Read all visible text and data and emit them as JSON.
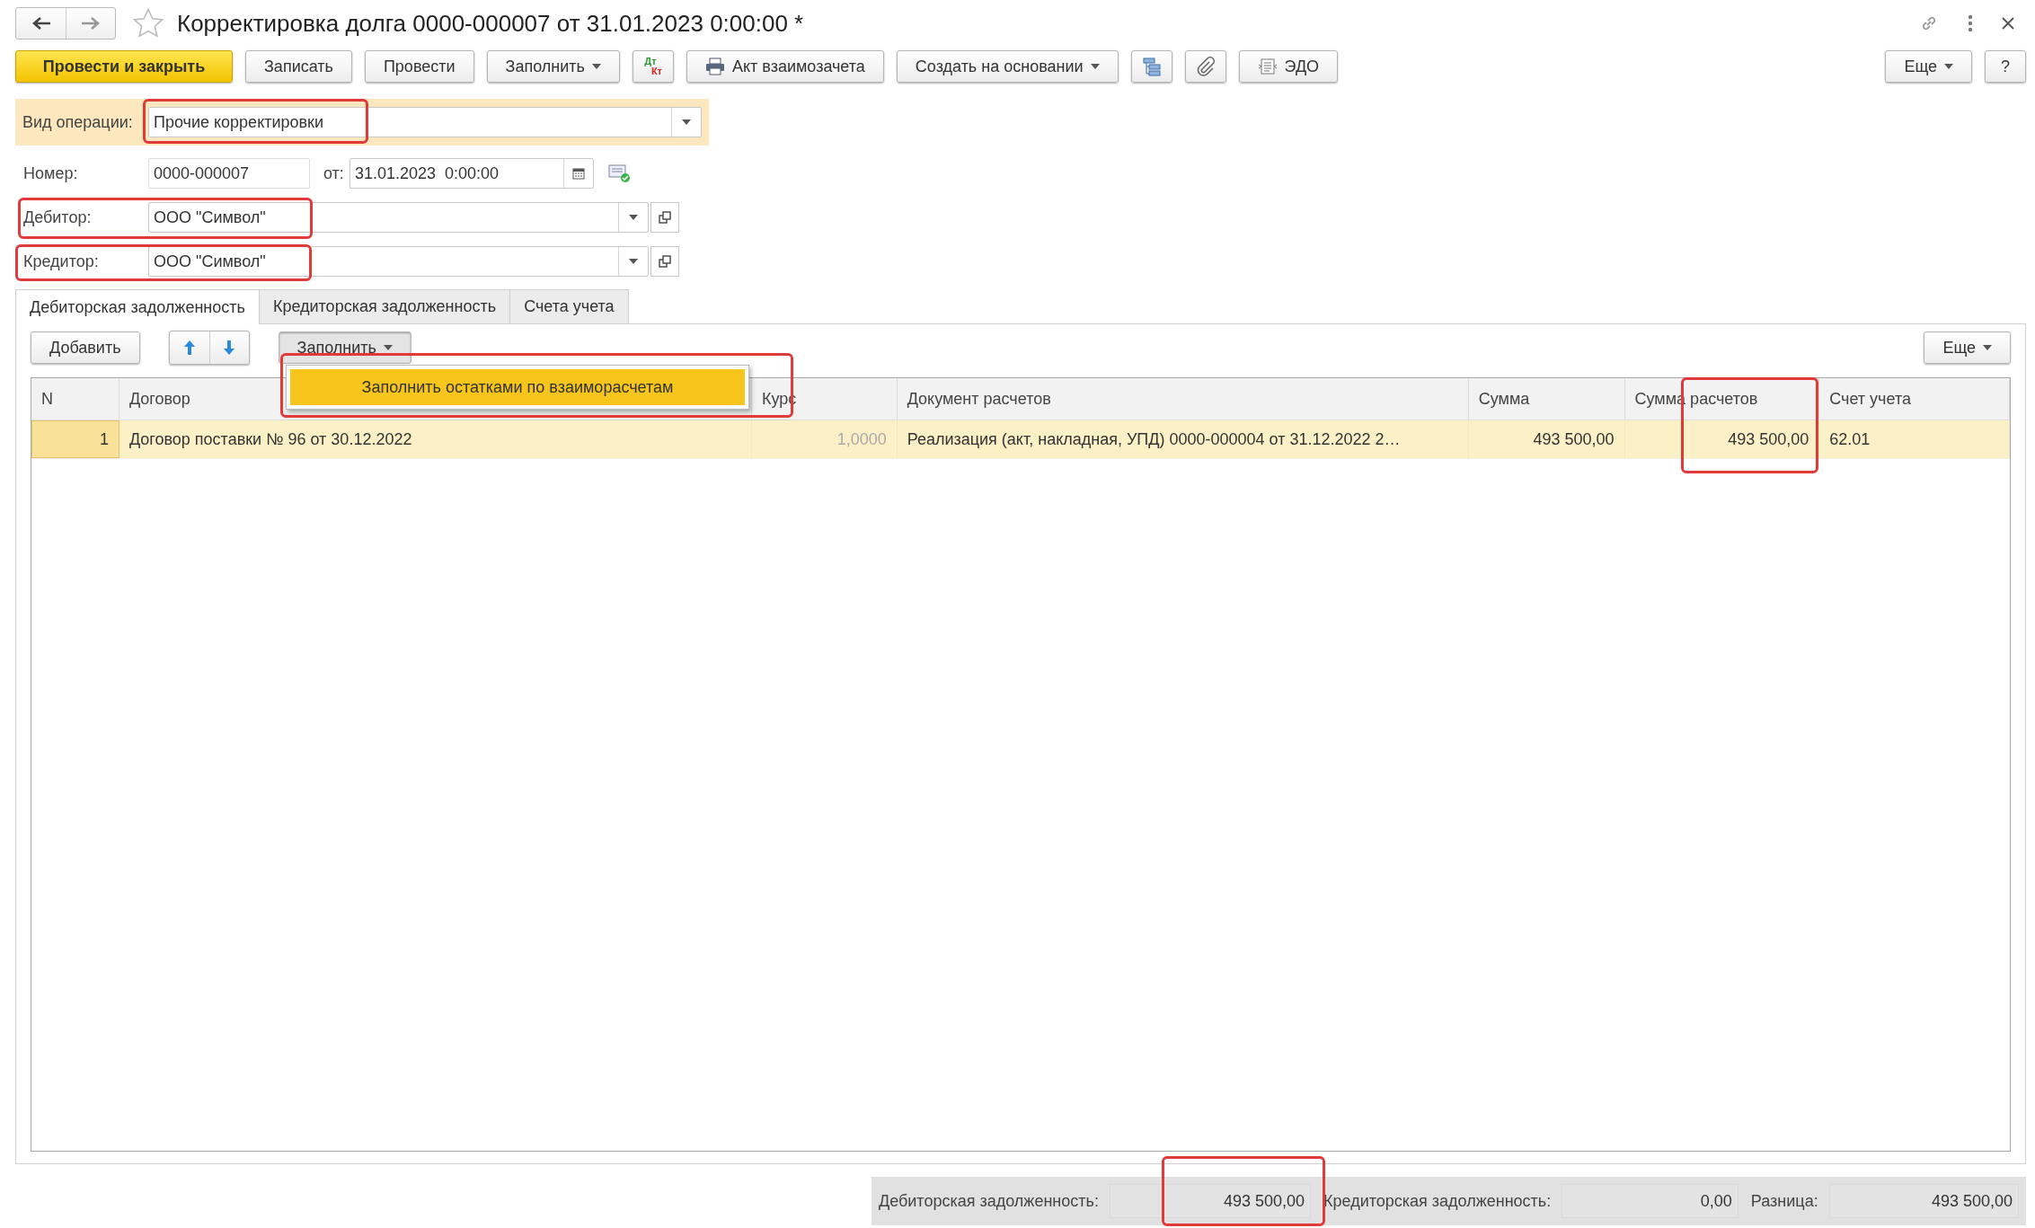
{
  "window": {
    "title": "Корректировка долга 0000-000007 от 31.01.2023 0:00:00 *",
    "starred": false
  },
  "toolbar": [
    {
      "kind": "primary",
      "label": "Провести и закрыть"
    },
    {
      "kind": "plain",
      "label": "Записать"
    },
    {
      "kind": "plain",
      "label": "Провести"
    },
    {
      "kind": "dropdown",
      "label": "Заполнить"
    },
    {
      "kind": "dtkt",
      "label": "Дт",
      "label2": "Кт"
    },
    {
      "kind": "print",
      "label": "Акт взаимозачета"
    },
    {
      "kind": "dropdown",
      "label": "Создать на основании"
    },
    {
      "kind": "structure"
    },
    {
      "kind": "clip"
    },
    {
      "kind": "edo",
      "label": "ЭДО"
    }
  ],
  "toolbar_right": [
    {
      "kind": "dropdown",
      "label": "Еще"
    },
    {
      "kind": "plain",
      "label": "?"
    }
  ],
  "operation": {
    "label": "Вид операции:",
    "value": "Прочие корректировки"
  },
  "number": {
    "label": "Номер:",
    "value": "0000-000007"
  },
  "date": {
    "label": "от:",
    "value": "31.01.2023  0:00:00"
  },
  "debtor": {
    "label": "Дебитор:",
    "value": "ООО \"Символ\""
  },
  "creditor": {
    "label": "Кредитор:",
    "value": "ООО \"Символ\""
  },
  "tabs": [
    {
      "label": "Дебиторская задолженность",
      "selected": true
    },
    {
      "label": "Кредиторская задолженность",
      "selected": false
    },
    {
      "label": "Счета учета",
      "selected": false
    }
  ],
  "table_toolbar": {
    "add": "Добавить",
    "fill": "Заполнить",
    "more": "Еще"
  },
  "fill_menu": [
    {
      "label": "Заполнить остатками по взаиморасчетам",
      "selected": true
    }
  ],
  "table": {
    "columns": [
      "N",
      "Договор",
      "Курс",
      "Документ расчетов",
      "Сумма",
      "Сумма расчетов",
      "Счет учета"
    ],
    "rows": [
      {
        "selected": true,
        "cells": [
          "1",
          "Договор поставки № 96 от 30.12.2022",
          "1,0000",
          "Реализация (акт, накладная, УПД) 0000-000004 от 31.12.2022 2…",
          "493 500,00",
          "493 500,00",
          "62.01"
        ]
      }
    ]
  },
  "totals": [
    {
      "label": "Дебиторская задолженность:",
      "value": "493 500,00"
    },
    {
      "label": "Кредиторская задолженность:",
      "value": "0,00"
    },
    {
      "label": "Разница:",
      "value": "493 500,00"
    }
  ]
}
